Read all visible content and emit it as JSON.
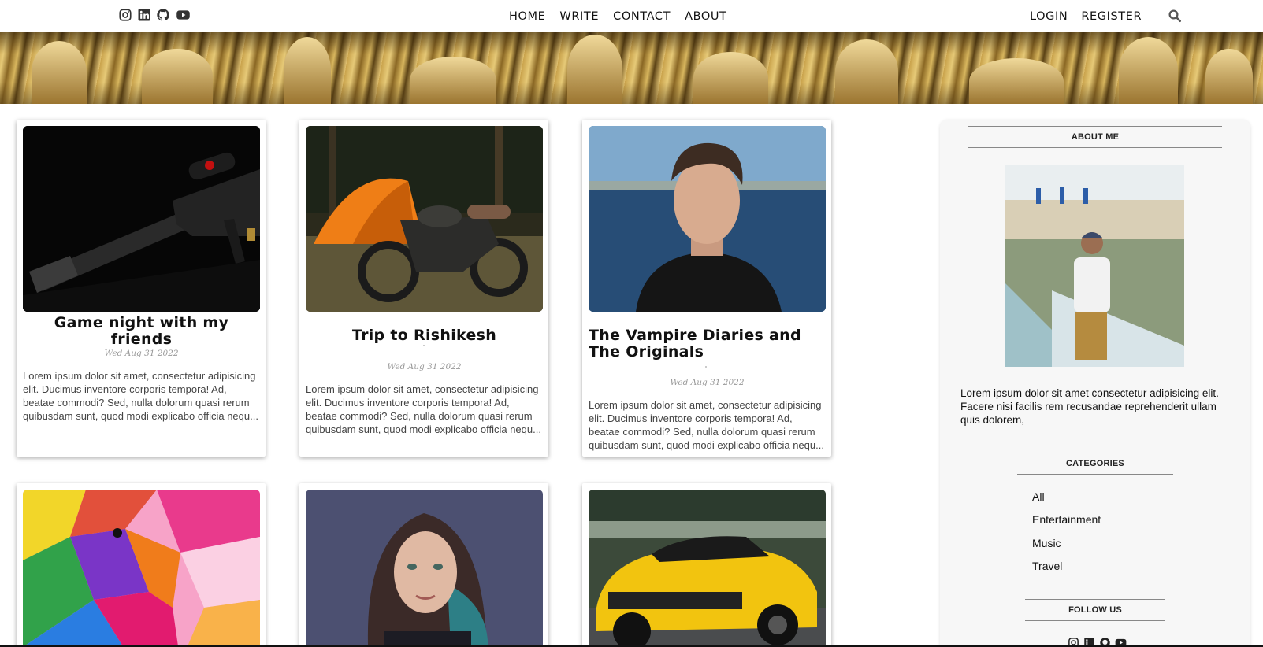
{
  "nav": {
    "social_icons": [
      "instagram-icon",
      "linkedin-icon",
      "github-icon",
      "youtube-icon"
    ],
    "center_links": [
      "HOME",
      "WRITE",
      "CONTACT",
      "ABOUT"
    ],
    "right_links": [
      "LOGIN",
      "REGISTER"
    ],
    "search_icon": "search-icon"
  },
  "posts": [
    {
      "title": "Game night with my friends",
      "date": "Wed Aug 31 2022",
      "desc": "Lorem ipsum dolor sit amet, consectetur adipisicing elit. Ducimus inventore corporis tempora! Ad, beatae commodi? Sed, nulla dolorum quasi rerum quibusdam sunt, quod modi explicabo officia nequ...",
      "image": "rifle-photo"
    },
    {
      "title": "Trip to Rishikesh",
      "date": "Wed Aug 31 2022",
      "desc": "Lorem ipsum dolor sit amet, consectetur adipisicing elit. Ducimus inventore corporis tempora! Ad, beatae commodi? Sed, nulla dolorum quasi rerum quibusdam sunt, quod modi explicabo officia nequ...",
      "image": "motorcycle-tent-photo"
    },
    {
      "title": "The Vampire Diaries and The Originals",
      "date": "Wed Aug 31 2022",
      "desc": "Lorem ipsum dolor sit amet, consectetur adipisicing elit. Ducimus inventore corporis tempora! Ad, beatae commodi? Sed, nulla dolorum quasi rerum quibusdam sunt, quod modi explicabo officia nequ...",
      "image": "man-portrait-photo"
    },
    {
      "image": "pop-art-lion-photo"
    },
    {
      "image": "woman-portrait-photo"
    },
    {
      "image": "yellow-car-photo"
    }
  ],
  "sidebar": {
    "about_heading": "ABOUT ME",
    "about_text": "Lorem ipsum dolor sit amet consectetur adipisicing elit. Facere nisi facilis rem recusandae reprehenderit ullam quis dolorem,",
    "categories_heading": "CATEGORIES",
    "categories": [
      "All",
      "Entertainment",
      "Music",
      "Travel"
    ],
    "follow_heading": "FOLLOW US",
    "follow_icons": [
      "instagram-icon",
      "linkedin-icon",
      "github-icon",
      "youtube-icon"
    ]
  }
}
